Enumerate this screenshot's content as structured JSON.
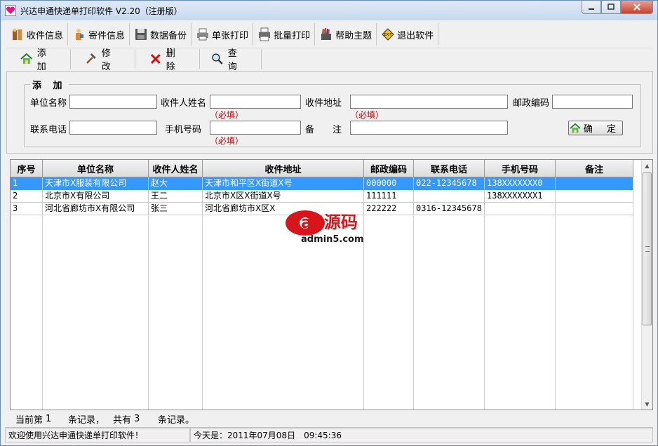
{
  "window": {
    "title": "兴达申通快递单打印软件 V2.20（注册版）"
  },
  "toolbar": [
    {
      "label": "收件信息",
      "icon": "recipient-info-icon"
    },
    {
      "label": "寄件信息",
      "icon": "sender-info-icon"
    },
    {
      "label": "数据备份",
      "icon": "data-backup-icon"
    },
    {
      "label": "单张打印",
      "icon": "single-print-icon"
    },
    {
      "label": "批量打印",
      "icon": "batch-print-icon"
    },
    {
      "label": "帮助主题",
      "icon": "help-icon"
    },
    {
      "label": "退出软件",
      "icon": "exit-icon"
    }
  ],
  "actions": [
    {
      "label": "添 加",
      "icon": "home-icon"
    },
    {
      "label": "修 改",
      "icon": "hammer-icon"
    },
    {
      "label": "删 除",
      "icon": "delete-x-icon"
    },
    {
      "label": "查 询",
      "icon": "magnifier-icon"
    }
  ],
  "form": {
    "legend": "添 加",
    "company_label": "单位名称",
    "recipient_label": "收件人姓名",
    "address_label": "收件地址",
    "postcode_label": "邮政编码",
    "phone_label": "联系电话",
    "mobile_label": "手机号码",
    "remark_label": "备　　注",
    "required_note": "（必填）",
    "confirm_label": "确 定",
    "company_value": "",
    "recipient_value": "",
    "address_value": "",
    "postcode_value": "",
    "phone_value": "",
    "mobile_value": "",
    "remark_value": ""
  },
  "grid": {
    "columns": [
      "序号",
      "单位名称",
      "收件人姓名",
      "收件地址",
      "邮政编码",
      "联系电话",
      "手机号码",
      "备注"
    ],
    "rows": [
      [
        "1",
        "天津市X服装有限公司",
        "赵大",
        "天津市和平区X街道X号",
        "000000",
        "022-12345678",
        "138XXXXXXX0",
        ""
      ],
      [
        "2",
        "北京市X有限公司",
        "王二",
        "北京市X区X街道X号",
        "111111",
        "",
        "138XXXXXXX1",
        ""
      ],
      [
        "3",
        "河北省廊坊市X有限公司",
        "张三",
        "河北省廊坊市X区X",
        "222222",
        "0316-12345678",
        "",
        ""
      ]
    ]
  },
  "watermark": {
    "brand": "a5源码",
    "domain": "admin5.com"
  },
  "record_bar": {
    "current_label": "当前第",
    "current_value": "1",
    "record_suffix": "条记录，",
    "total_label": "共有",
    "total_value": "3",
    "total_suffix": "条记录。"
  },
  "status": {
    "welcome": "欢迎使用兴达申通快递单打印软件！",
    "today": "今天是：2011年07月08日　09:45:36"
  },
  "colors": {
    "selection": "#3399ff",
    "required": "#c00000"
  }
}
